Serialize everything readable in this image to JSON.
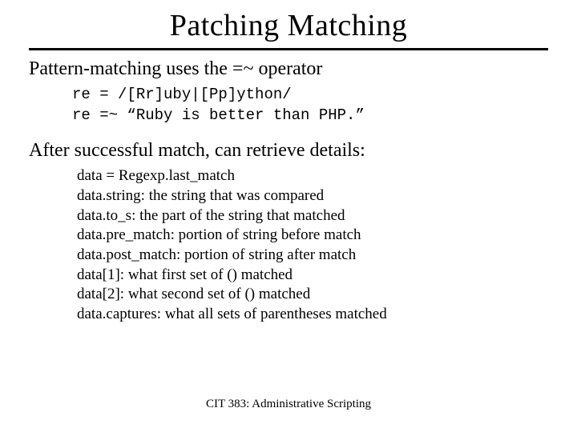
{
  "title": "Patching Matching",
  "lead1": "Pattern-matching uses the =~ operator",
  "code": {
    "line1": "re = /[Rr]uby|[Pp]ython/",
    "line2": "re =~ “Ruby is better than PHP.”"
  },
  "lead2": "After successful match, can retrieve details:",
  "details": {
    "d1": "data = Regexp.last_match",
    "d2": "data.string: the string that was compared",
    "d3": "data.to_s: the part of the string that matched",
    "d4": "data.pre_match: portion of string before match",
    "d5": "data.post_match: portion of string after match",
    "d6": "data[1]: what first set of () matched",
    "d7": "data[2]: what second set of () matched",
    "d8": "data.captures: what all sets of parentheses matched"
  },
  "footer": "CIT 383: Administrative Scripting"
}
